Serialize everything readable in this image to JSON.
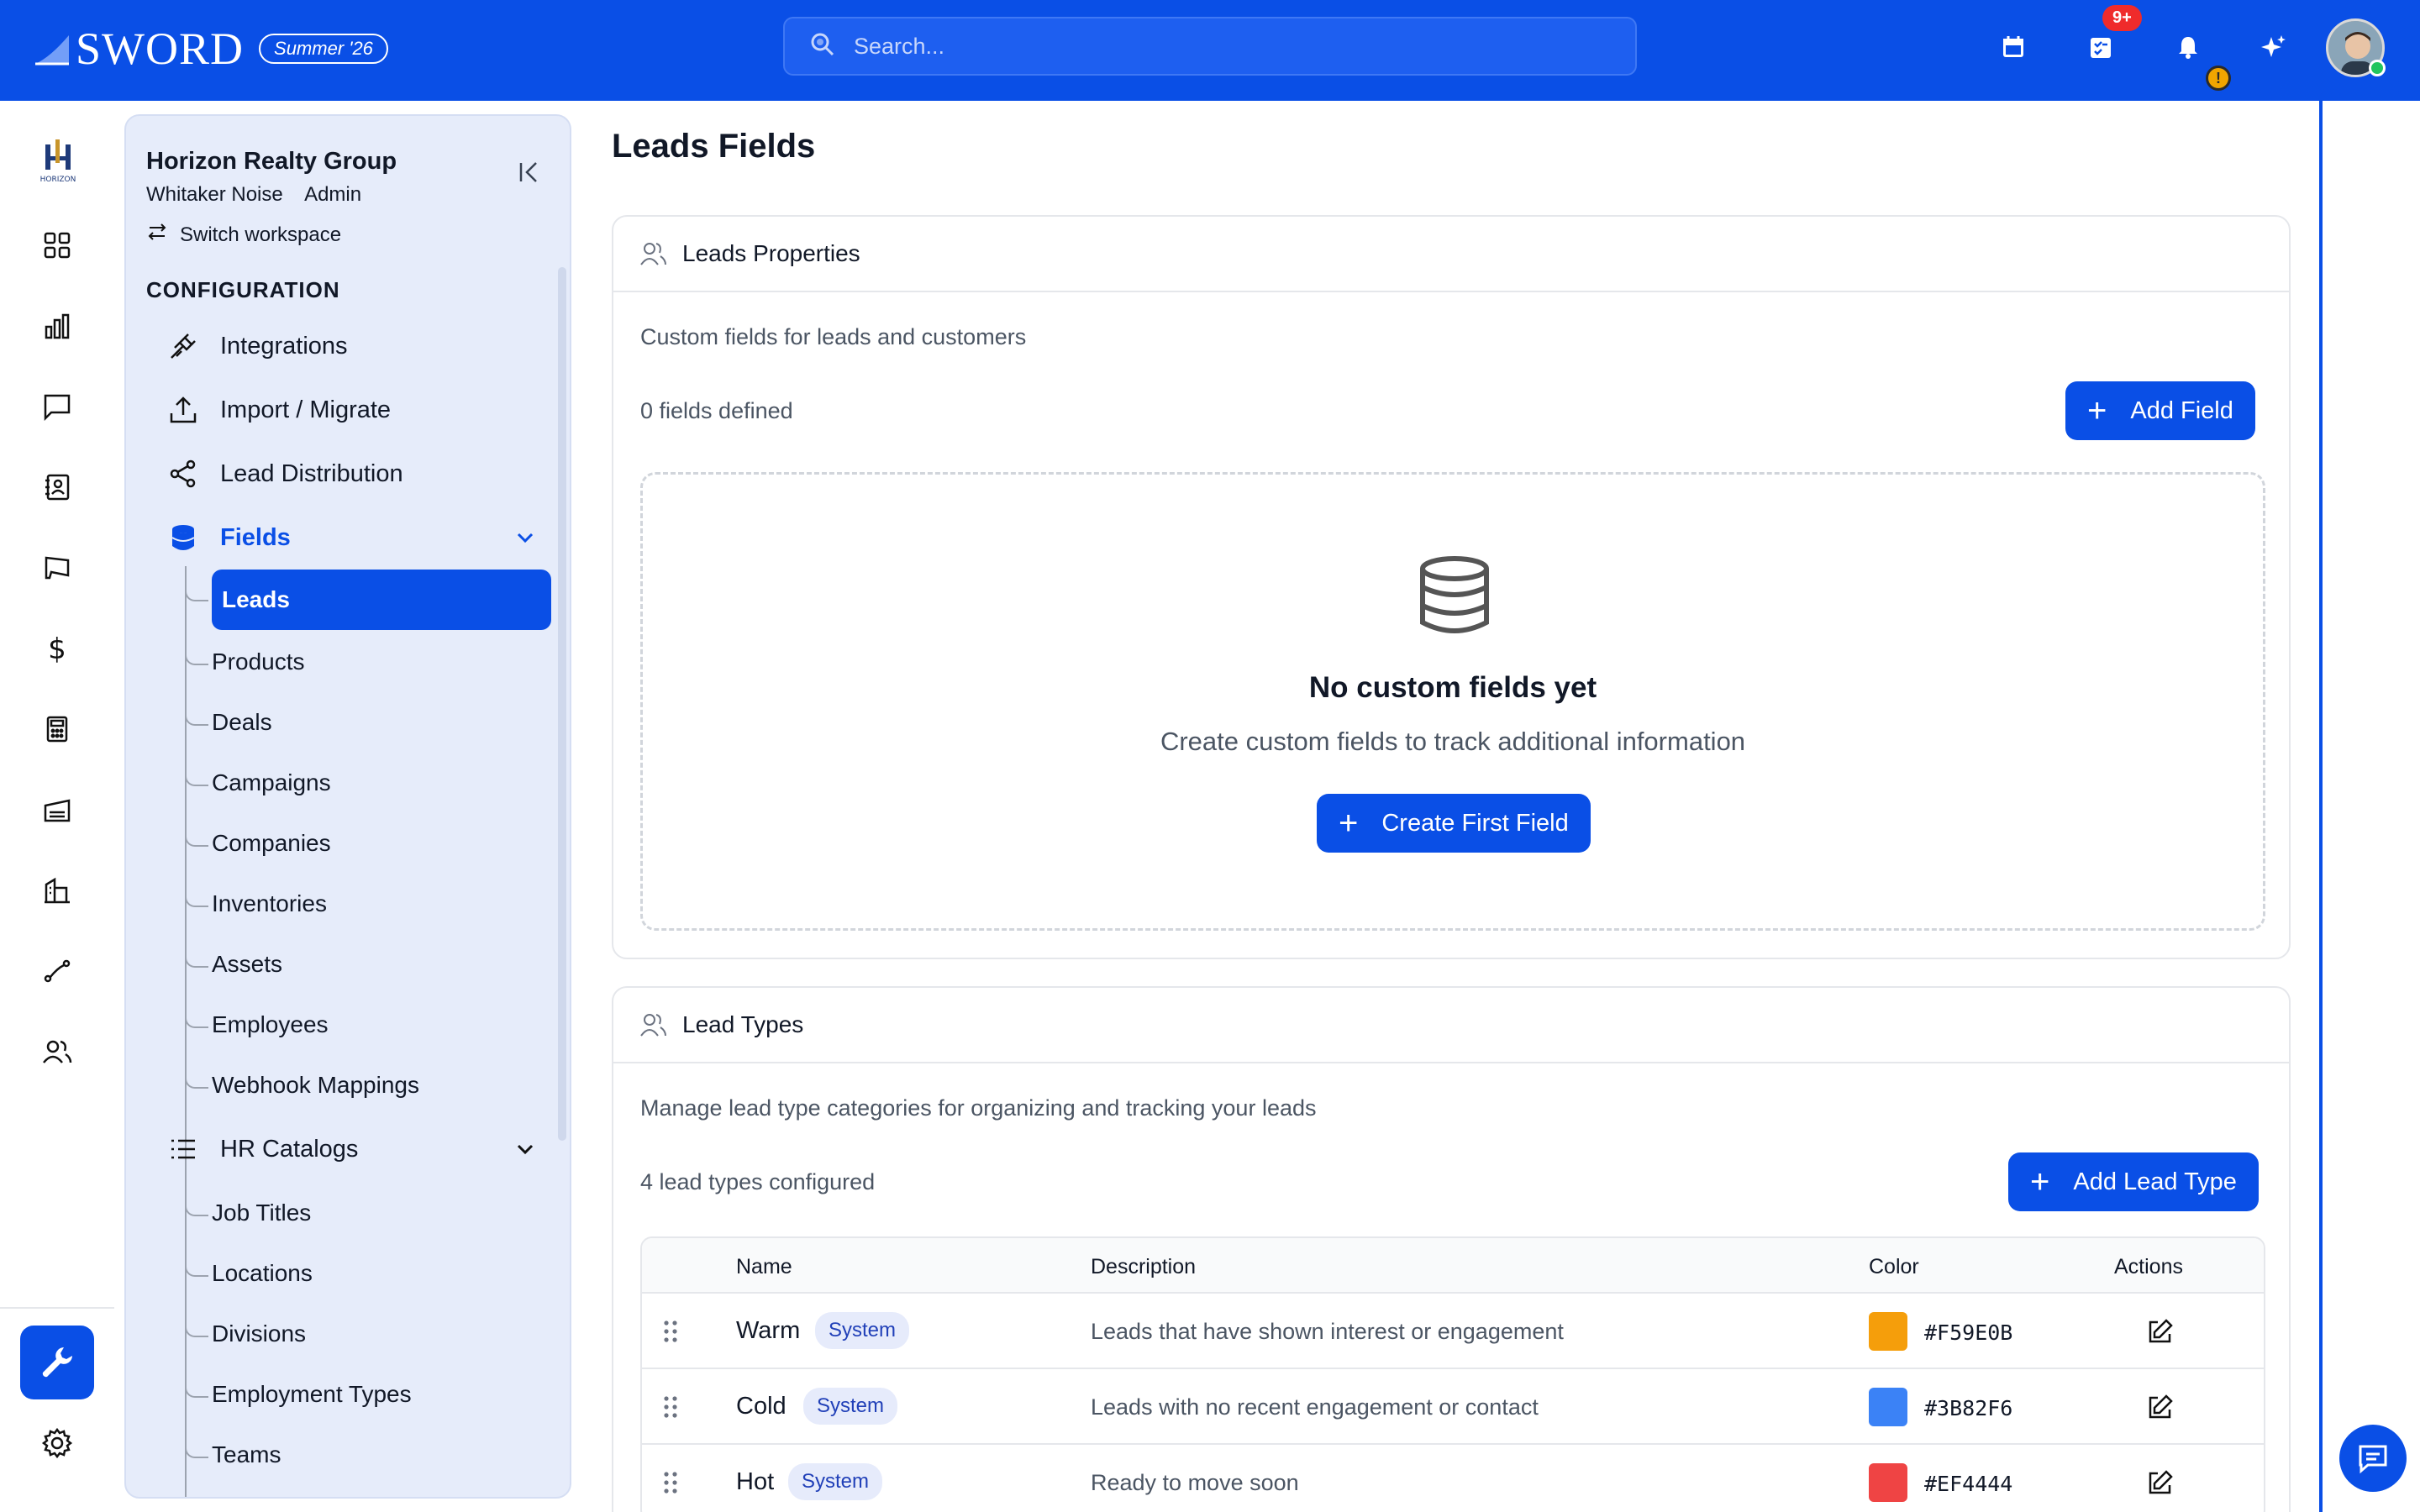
{
  "colors": {
    "brand": "#0a4fe6",
    "sidebar_bg": "#e6ecfa",
    "warm": "#F59E0B",
    "cold": "#3B82F6",
    "hot": "#EF4444"
  },
  "topbar": {
    "brand": "SWORD",
    "release_badge": "Summer '26",
    "search_placeholder": "Search...",
    "tasks_badge": "9+",
    "alert_badge": "!"
  },
  "sidebar": {
    "workspace_name": "Horizon Realty Group",
    "user_name": "Whitaker Noise",
    "role": "Admin",
    "switch_label": "Switch workspace",
    "section_title": "CONFIGURATION",
    "items": [
      {
        "label": "Integrations",
        "icon": "plug-icon"
      },
      {
        "label": "Import / Migrate",
        "icon": "upload-icon"
      },
      {
        "label": "Lead Distribution",
        "icon": "share-icon"
      },
      {
        "label": "Fields",
        "icon": "database-icon"
      }
    ],
    "fields_children": [
      "Leads",
      "Products",
      "Deals",
      "Campaigns",
      "Companies",
      "Inventories",
      "Assets",
      "Employees",
      "Webhook Mappings"
    ],
    "hr_catalogs_label": "HR Catalogs",
    "hr_children": [
      "Job Titles",
      "Locations",
      "Divisions",
      "Employment Types",
      "Teams"
    ]
  },
  "page": {
    "title": "Leads Fields"
  },
  "leads_properties": {
    "title": "Leads Properties",
    "description": "Custom fields for leads and customers",
    "count": "0 fields defined",
    "add_button": "Add Field",
    "empty_title": "No custom fields yet",
    "empty_subtitle": "Create custom fields to track additional information",
    "create_button": "Create First Field"
  },
  "lead_types": {
    "title": "Lead Types",
    "description": "Manage lead type categories for organizing and tracking your leads",
    "count": "4 lead types configured",
    "add_button": "Add Lead Type",
    "columns": {
      "name": "Name",
      "description": "Description",
      "color": "Color",
      "actions": "Actions"
    },
    "rows": [
      {
        "name": "Warm",
        "tag": "System",
        "description": "Leads that have shown interest or engagement",
        "color": "#F59E0B",
        "hex": "#F59E0B"
      },
      {
        "name": "Cold",
        "tag": "System",
        "description": "Leads with no recent engagement or contact",
        "color": "#3B82F6",
        "hex": "#3B82F6"
      },
      {
        "name": "Hot",
        "tag": "System",
        "description": "Ready to move soon",
        "color": "#EF4444",
        "hex": "#EF4444"
      }
    ]
  }
}
